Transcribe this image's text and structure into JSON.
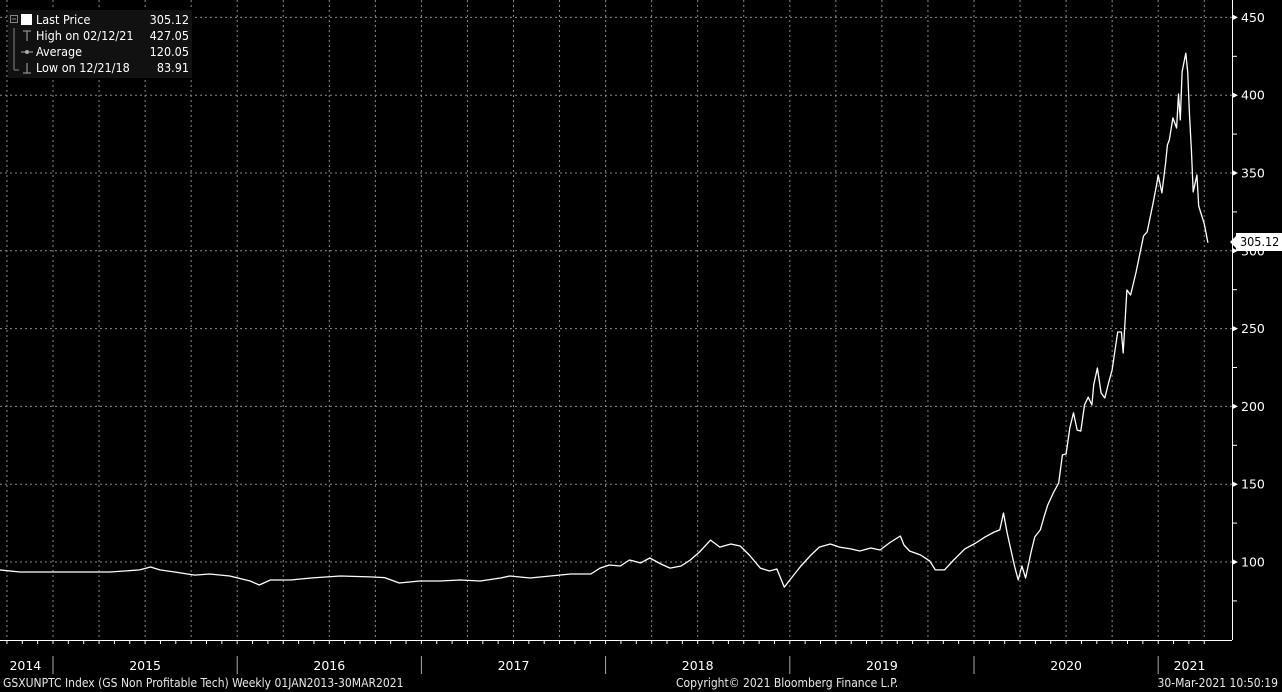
{
  "legend": {
    "last_price_label": "Last Price",
    "last_price_value": "305.12",
    "high_label": "High on 02/12/21",
    "high_value": "427.05",
    "average_label": "Average",
    "average_value": "120.05",
    "low_label": "Low on 12/21/18",
    "low_value": "83.91"
  },
  "last_price_tag": "305.12",
  "footer": {
    "ticker": "GSXUNPTC Index (GS Non Profitable Tech)  Weekly 01JAN2013-30MAR2021",
    "copyright": "Copyright© 2021 Bloomberg Finance L.P.",
    "timestamp": "30-Mar-2021 10:50:19"
  },
  "colors": {
    "background": "#000000",
    "line": "#ffffff",
    "grid": "#8a8a8a"
  },
  "chart_data": {
    "type": "line",
    "title": "GSXUNPTC Index (GS Non Profitable Tech)",
    "frequency": "Weekly",
    "xlabel": "",
    "ylabel": "",
    "ylim": [
      75,
      455
    ],
    "xlim": [
      2014.71,
      2021.34
    ],
    "y_ticks": [
      100,
      150,
      200,
      250,
      300,
      350,
      400,
      450
    ],
    "x_tick_labels": [
      {
        "label": "2014",
        "at": 2014.85
      },
      {
        "label": "2015",
        "at": 2015.5
      },
      {
        "label": "2016",
        "at": 2016.5
      },
      {
        "label": "2017",
        "at": 2017.5
      },
      {
        "label": "2018",
        "at": 2018.5
      },
      {
        "label": "2019",
        "at": 2019.5
      },
      {
        "label": "2020",
        "at": 2020.5
      },
      {
        "label": "2021",
        "at": 2021.17
      }
    ],
    "year_boundaries": [
      2015,
      2016,
      2017,
      2018,
      2019,
      2020,
      2021
    ],
    "grid": true,
    "legend_position": "top-left",
    "series": [
      {
        "name": "Last Price",
        "points": [
          [
            2014.71,
            94.9
          ],
          [
            2014.82,
            93.6
          ],
          [
            2014.98,
            93.6
          ],
          [
            2015.15,
            93.6
          ],
          [
            2015.31,
            93.6
          ],
          [
            2015.47,
            94.9
          ],
          [
            2015.53,
            96.8
          ],
          [
            2015.58,
            94.9
          ],
          [
            2015.66,
            93.6
          ],
          [
            2015.77,
            91.6
          ],
          [
            2015.85,
            92.3
          ],
          [
            2015.96,
            91.0
          ],
          [
            2016.07,
            87.8
          ],
          [
            2016.12,
            85.2
          ],
          [
            2016.18,
            88.4
          ],
          [
            2016.29,
            88.4
          ],
          [
            2016.4,
            89.7
          ],
          [
            2016.56,
            91.0
          ],
          [
            2016.72,
            90.4
          ],
          [
            2016.8,
            90.0
          ],
          [
            2016.88,
            86.5
          ],
          [
            2016.99,
            87.8
          ],
          [
            2017.1,
            87.8
          ],
          [
            2017.21,
            88.4
          ],
          [
            2017.32,
            87.8
          ],
          [
            2017.43,
            89.7
          ],
          [
            2017.48,
            91.0
          ],
          [
            2017.59,
            89.7
          ],
          [
            2017.7,
            91.0
          ],
          [
            2017.81,
            92.3
          ],
          [
            2017.92,
            92.3
          ],
          [
            2017.97,
            96.1
          ],
          [
            2018.02,
            98.1
          ],
          [
            2018.08,
            97.4
          ],
          [
            2018.13,
            101.3
          ],
          [
            2018.19,
            99.4
          ],
          [
            2018.24,
            102.6
          ],
          [
            2018.3,
            98.7
          ],
          [
            2018.35,
            96.1
          ],
          [
            2018.41,
            97.4
          ],
          [
            2018.46,
            101.3
          ],
          [
            2018.51,
            106.4
          ],
          [
            2018.57,
            114.1
          ],
          [
            2018.62,
            109.6
          ],
          [
            2018.68,
            111.6
          ],
          [
            2018.73,
            110.3
          ],
          [
            2018.78,
            104.5
          ],
          [
            2018.84,
            96.1
          ],
          [
            2018.89,
            94.2
          ],
          [
            2018.93,
            95.5
          ],
          [
            2018.97,
            83.9
          ],
          [
            2019.0,
            88.4
          ],
          [
            2019.06,
            97.4
          ],
          [
            2019.11,
            103.9
          ],
          [
            2019.16,
            109.6
          ],
          [
            2019.22,
            111.6
          ],
          [
            2019.27,
            109.6
          ],
          [
            2019.33,
            108.4
          ],
          [
            2019.38,
            107.1
          ],
          [
            2019.44,
            109.0
          ],
          [
            2019.49,
            107.7
          ],
          [
            2019.54,
            112.2
          ],
          [
            2019.6,
            116.7
          ],
          [
            2019.62,
            110.9
          ],
          [
            2019.65,
            107.1
          ],
          [
            2019.71,
            104.5
          ],
          [
            2019.76,
            100.6
          ],
          [
            2019.79,
            94.9
          ],
          [
            2019.84,
            94.9
          ],
          [
            2019.89,
            101.3
          ],
          [
            2019.95,
            108.4
          ],
          [
            2020.01,
            112.2
          ],
          [
            2020.06,
            116.1
          ],
          [
            2020.11,
            119.3
          ],
          [
            2020.14,
            120.6
          ],
          [
            2020.16,
            131.5
          ],
          [
            2020.18,
            118.6
          ],
          [
            2020.22,
            97.4
          ],
          [
            2020.24,
            88.4
          ],
          [
            2020.26,
            97.4
          ],
          [
            2020.28,
            89.7
          ],
          [
            2020.31,
            106.4
          ],
          [
            2020.33,
            116.1
          ],
          [
            2020.36,
            120.6
          ],
          [
            2020.38,
            128.9
          ],
          [
            2020.4,
            136.6
          ],
          [
            2020.43,
            144.3
          ],
          [
            2020.46,
            150.8
          ],
          [
            2020.48,
            168.8
          ],
          [
            2020.5,
            169.4
          ],
          [
            2020.52,
            186.1
          ],
          [
            2020.54,
            195.8
          ],
          [
            2020.56,
            184.8
          ],
          [
            2020.58,
            184.1
          ],
          [
            2020.6,
            200.9
          ],
          [
            2020.62,
            206.0
          ],
          [
            2020.64,
            200.9
          ],
          [
            2020.65,
            213.8
          ],
          [
            2020.67,
            224.7
          ],
          [
            2020.69,
            208.6
          ],
          [
            2020.71,
            205.4
          ],
          [
            2020.73,
            215.0
          ],
          [
            2020.75,
            223.4
          ],
          [
            2020.78,
            247.8
          ],
          [
            2020.8,
            247.8
          ],
          [
            2020.81,
            234.3
          ],
          [
            2020.83,
            274.8
          ],
          [
            2020.85,
            271.6
          ],
          [
            2020.88,
            286.4
          ],
          [
            2020.92,
            309.5
          ],
          [
            2020.94,
            312.1
          ],
          [
            2020.97,
            329.4
          ],
          [
            2020.99,
            341.7
          ],
          [
            2021.0,
            348.7
          ],
          [
            2021.02,
            337.2
          ],
          [
            2021.04,
            356.4
          ],
          [
            2021.05,
            368.0
          ],
          [
            2021.06,
            371.2
          ],
          [
            2021.08,
            385.4
          ],
          [
            2021.1,
            378.9
          ],
          [
            2021.11,
            400.8
          ],
          [
            2021.12,
            384.1
          ],
          [
            2021.13,
            415.0
          ],
          [
            2021.15,
            427.05
          ],
          [
            2021.16,
            414.9
          ],
          [
            2021.17,
            387.3
          ],
          [
            2021.18,
            364.8
          ],
          [
            2021.19,
            337.8
          ],
          [
            2021.21,
            348.7
          ],
          [
            2021.22,
            328.8
          ],
          [
            2021.25,
            317.2
          ],
          [
            2021.27,
            305.12
          ]
        ]
      }
    ]
  }
}
